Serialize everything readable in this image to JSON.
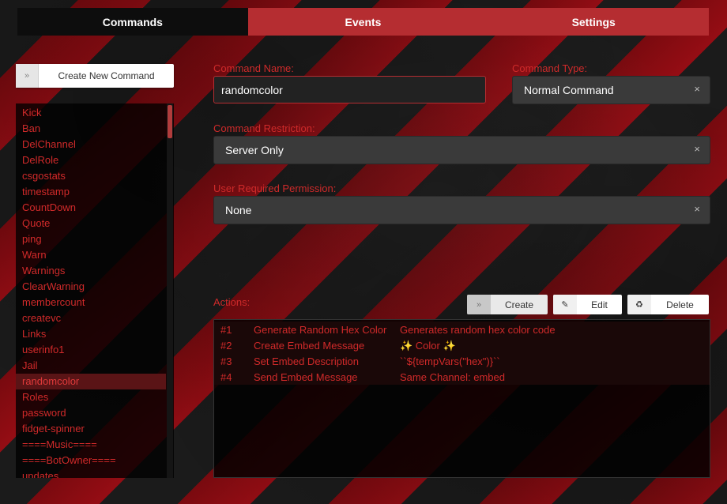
{
  "tabs": [
    {
      "label": "Commands"
    },
    {
      "label": "Events"
    },
    {
      "label": "Settings"
    }
  ],
  "sidebar": {
    "create_button_icon": "»",
    "create_button_label": "Create New Command",
    "commands": [
      "Kick",
      "Ban",
      "DelChannel",
      "DelRole",
      "csgostats",
      "timestamp",
      "CountDown",
      "Quote",
      "ping",
      "Warn",
      "Warnings",
      "ClearWarning",
      "membercount",
      "createvc",
      "Links",
      "userinfo1",
      "Jail",
      "randomcolor",
      "Roles",
      "password",
      "fidget-spinner",
      "====Music====",
      "====BotOwner====",
      "updates"
    ],
    "selected": "randomcolor"
  },
  "form": {
    "command_name_label": "Command Name:",
    "command_name_value": "randomcolor",
    "command_type_label": "Command Type:",
    "command_type_value": "Normal Command",
    "restriction_label": "Command Restriction:",
    "restriction_value": "Server Only",
    "permission_label": "User Required Permission:",
    "permission_value": "None",
    "clear_glyph": "×"
  },
  "actions": {
    "label": "Actions:",
    "create_icon": "»",
    "create_label": "Create",
    "edit_icon": "✎",
    "edit_label": "Edit",
    "delete_icon": "♻",
    "delete_label": "Delete",
    "rows": [
      {
        "num": "#1",
        "name": "Generate Random Hex Color",
        "desc": "Generates random hex color code"
      },
      {
        "num": "#2",
        "name": "Create Embed Message",
        "desc": "✨ Color ✨"
      },
      {
        "num": "#3",
        "name": "Set Embed Description",
        "desc": "``${tempVars(\"hex\")}``"
      },
      {
        "num": "#4",
        "name": "Send Embed Message",
        "desc": "Same Channel: embed"
      }
    ]
  },
  "colors": {
    "accent": "#b52d31",
    "text_red": "#d12a2a",
    "tab_active_bg": "#0d0d0d"
  }
}
